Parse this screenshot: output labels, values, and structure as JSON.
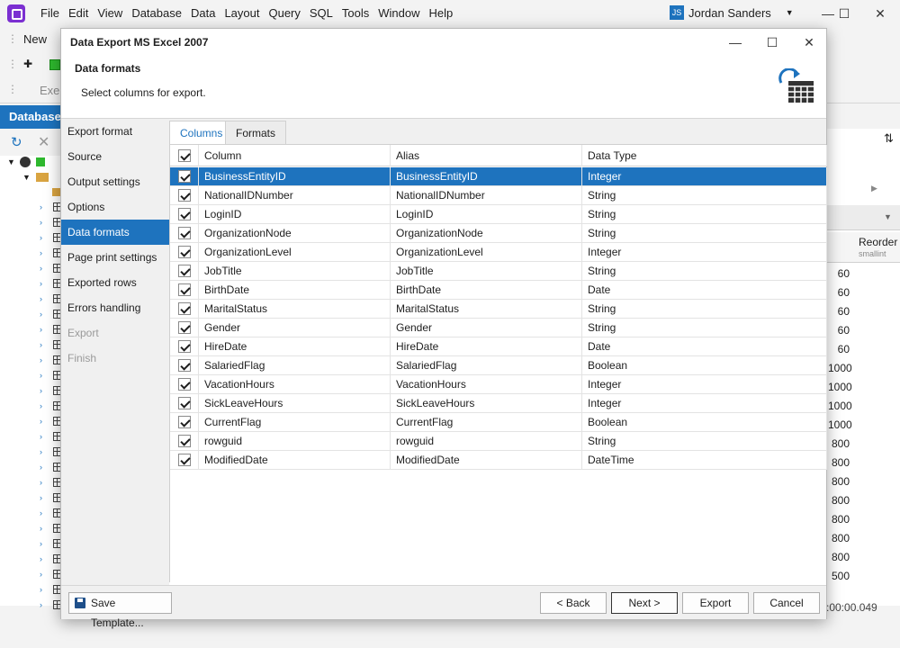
{
  "menu": [
    "File",
    "Edit",
    "View",
    "Database",
    "Data",
    "Layout",
    "Query",
    "SQL",
    "Tools",
    "Window",
    "Help"
  ],
  "user": {
    "initials": "JS",
    "name": "Jordan  Sanders"
  },
  "background": {
    "toolbar_new": "New",
    "toolbar_exec": "Exec",
    "db_panel_title": "Database",
    "column_header": "Reorder",
    "column_type": "smallint",
    "values": [
      "60",
      "60",
      "60",
      "60",
      "60",
      "1000",
      "1000",
      "1000",
      "1000",
      "800",
      "800",
      "800",
      "800",
      "800",
      "800",
      "800",
      "500"
    ],
    "status_time": ":00:00.049"
  },
  "dialog": {
    "title": "Data Export MS Excel 2007",
    "page_title": "Data formats",
    "page_subtitle": "Select columns for export.",
    "nav": [
      "Export format",
      "Source",
      "Output settings",
      "Options",
      "Data formats",
      "Page print settings",
      "Exported rows",
      "Errors handling",
      "Export",
      "Finish"
    ],
    "tabs": [
      "Columns",
      "Formats"
    ],
    "grid_headers": [
      "Column",
      "Alias",
      "Data Type"
    ],
    "rows": [
      [
        "BusinessEntityID",
        "BusinessEntityID",
        "Integer"
      ],
      [
        "NationalIDNumber",
        "NationalIDNumber",
        "String"
      ],
      [
        "LoginID",
        "LoginID",
        "String"
      ],
      [
        "OrganizationNode",
        "OrganizationNode",
        "String"
      ],
      [
        "OrganizationLevel",
        "OrganizationLevel",
        "Integer"
      ],
      [
        "JobTitle",
        "JobTitle",
        "String"
      ],
      [
        "BirthDate",
        "BirthDate",
        "Date"
      ],
      [
        "MaritalStatus",
        "MaritalStatus",
        "String"
      ],
      [
        "Gender",
        "Gender",
        "String"
      ],
      [
        "HireDate",
        "HireDate",
        "Date"
      ],
      [
        "SalariedFlag",
        "SalariedFlag",
        "Boolean"
      ],
      [
        "VacationHours",
        "VacationHours",
        "Integer"
      ],
      [
        "SickLeaveHours",
        "SickLeaveHours",
        "Integer"
      ],
      [
        "CurrentFlag",
        "CurrentFlag",
        "Boolean"
      ],
      [
        "rowguid",
        "rowguid",
        "String"
      ],
      [
        "ModifiedDate",
        "ModifiedDate",
        "DateTime"
      ]
    ],
    "buttons": {
      "save_template": "Save Template...",
      "back": "< Back",
      "next": "Next >",
      "export": "Export",
      "cancel": "Cancel"
    }
  }
}
